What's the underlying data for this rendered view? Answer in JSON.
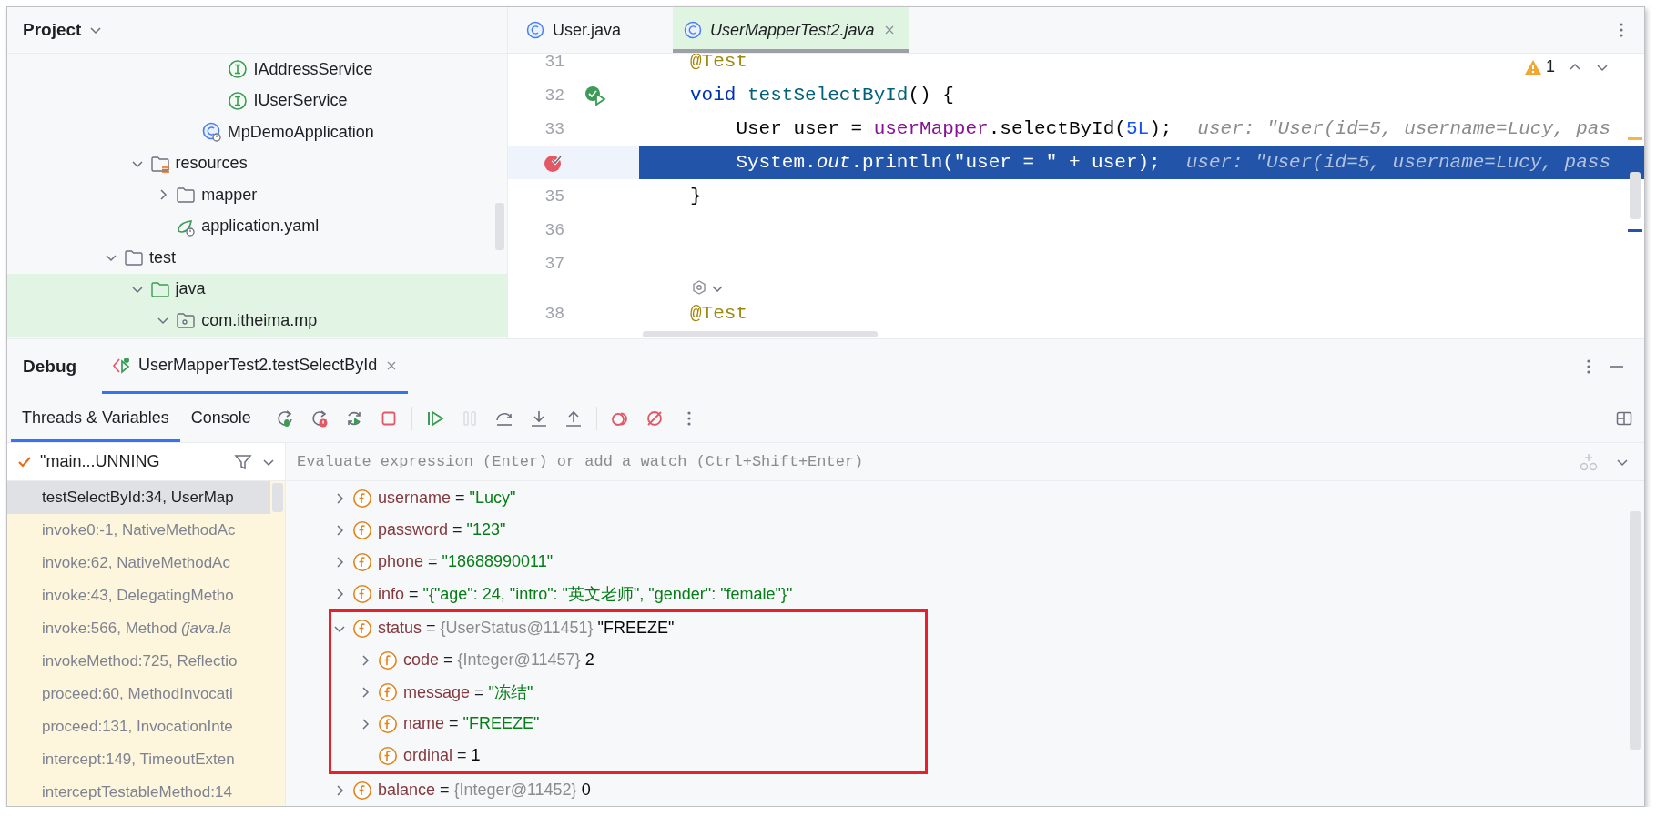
{
  "project_panel": {
    "title": "Project",
    "tree": [
      {
        "children": [
          {
            "children": [
              {
                "children": [
                  {
                    "children": [
                      {
                        "label": "IAddressService",
                        "kind": "interface",
                        "highlighted": false
                      },
                      {
                        "label": "IUserService",
                        "kind": "interface",
                        "highlighted": false
                      }
                    ]
                  },
                  {
                    "label": "MpDemoApplication",
                    "kind": "app-class",
                    "highlighted": false
                  }
                ]
              }
            ]
          },
          {
            "label": "resources",
            "kind": "resource-folder",
            "expanded": true,
            "highlighted": false,
            "children": [
              {
                "label": "mapper",
                "kind": "folder",
                "expanded": false,
                "highlighted": false
              },
              {
                "label": "application.yaml",
                "kind": "yaml",
                "highlighted": false
              }
            ]
          }
        ]
      },
      {
        "label": "test",
        "kind": "folder",
        "expanded": true,
        "highlighted": false,
        "children": [
          {
            "label": "java",
            "kind": "test-folder",
            "expanded": true,
            "highlighted": true,
            "children": [
              {
                "label": "com.itheima.mp",
                "kind": "package",
                "expanded": true,
                "highlighted": true
              }
            ]
          }
        ]
      }
    ]
  },
  "editor": {
    "tabs": [
      {
        "label": "User.java",
        "selected": false
      },
      {
        "label": "UserMapperTest2.java",
        "selected": true
      }
    ],
    "warning_count": "1",
    "lines": [
      {
        "kind": "code",
        "number": "31",
        "current": false,
        "run_marker": false,
        "breakpoint": false,
        "tokens": [
          {
            "text": "@Test",
            "kind": "annotation"
          }
        ]
      },
      {
        "kind": "code",
        "number": "32",
        "current": false,
        "run_marker": true,
        "breakpoint": false,
        "tokens": [
          {
            "text": "void ",
            "kind": "keyword"
          },
          {
            "text": "testSelectById",
            "kind": "method"
          },
          {
            "text": "() {",
            "kind": "plain"
          }
        ]
      },
      {
        "kind": "code",
        "number": "33",
        "current": false,
        "run_marker": false,
        "breakpoint": false,
        "tokens": [
          {
            "text": "    User user = ",
            "kind": "plain"
          },
          {
            "text": "userMapper",
            "kind": "field"
          },
          {
            "text": ".selectById(",
            "kind": "plain"
          },
          {
            "text": "5L",
            "kind": "number"
          },
          {
            "text": ");",
            "kind": "plain"
          }
        ],
        "hint": "user: \"User(id=5, username=Lucy, pas"
      },
      {
        "kind": "code",
        "current": true,
        "run_marker": false,
        "breakpoint": true,
        "tokens": [
          {
            "text": "    System.",
            "kind": "plain"
          },
          {
            "text": "out",
            "kind": "static"
          },
          {
            "text": ".println(\"user = \" + user);",
            "kind": "plain"
          }
        ],
        "hint": "user: \"User(id=5, username=Lucy, pass"
      },
      {
        "kind": "code",
        "number": "35",
        "current": false,
        "run_marker": false,
        "breakpoint": false,
        "tokens": [
          {
            "text": "}",
            "kind": "plain"
          }
        ]
      },
      {
        "kind": "code",
        "number": "36",
        "current": false,
        "run_marker": false,
        "breakpoint": false
      },
      {
        "kind": "code",
        "number": "37",
        "current": false,
        "run_marker": false,
        "breakpoint": false
      },
      {
        "kind": "inlay"
      },
      {
        "kind": "code",
        "number": "38",
        "current": false,
        "run_marker": false,
        "breakpoint": false,
        "tokens": [
          {
            "text": "@Test",
            "kind": "annotation"
          }
        ]
      }
    ]
  },
  "debug": {
    "title": "Debug",
    "session_tab": {
      "label": "UserMapperTest2.testSelectById"
    },
    "tabs": [
      {
        "label": "Threads & Variables",
        "selected": true
      },
      {
        "label": "Console",
        "selected": false
      }
    ],
    "toolbar": [
      {
        "kind": "rerun",
        "disabled": false
      },
      {
        "kind": "rerun-failed",
        "disabled": false
      },
      {
        "kind": "restart",
        "disabled": false
      },
      {
        "kind": "stop",
        "disabled": false
      },
      {
        "kind": "separator"
      },
      {
        "kind": "resume",
        "disabled": false
      },
      {
        "kind": "pause",
        "disabled": true
      },
      {
        "kind": "step-over",
        "disabled": false
      },
      {
        "kind": "step-into",
        "disabled": false
      },
      {
        "kind": "step-out",
        "disabled": false
      },
      {
        "kind": "separator"
      },
      {
        "kind": "breakpoints",
        "disabled": false
      },
      {
        "kind": "mute-breakpoints",
        "disabled": false
      },
      {
        "kind": "more",
        "disabled": false
      }
    ],
    "thread": {
      "label": "\"main...UNNING"
    },
    "frames": [
      {
        "text": "testSelectById:34, UserMap",
        "selected": true,
        "library": false
      },
      {
        "text": "invoke0:-1, NativeMethodAc",
        "selected": false,
        "library": true
      },
      {
        "text": "invoke:62, NativeMethodAc",
        "selected": false,
        "library": true
      },
      {
        "text": "invoke:43, DelegatingMetho",
        "selected": false,
        "library": true
      },
      {
        "text": "invoke:566, Method *(java.la*",
        "selected": false,
        "library": true
      },
      {
        "text": "invokeMethod:725, Reflectio",
        "selected": false,
        "library": true
      },
      {
        "text": "proceed:60, MethodInvocati",
        "selected": false,
        "library": true
      },
      {
        "text": "proceed:131, InvocationInte",
        "selected": false,
        "library": true
      },
      {
        "text": "intercept:149, TimeoutExten",
        "selected": false,
        "library": true
      },
      {
        "text": "interceptTestableMethod:14",
        "selected": false,
        "library": true
      }
    ],
    "evaluate": {
      "placeholder": "Evaluate expression (Enter) or add a watch (Ctrl+Shift+Enter)"
    },
    "variables": [
      {
        "name": "username",
        "operator": "=",
        "value": "\"Lucy\"",
        "kind": "string",
        "expanded": false,
        "boxed": false
      },
      {
        "name": "password",
        "operator": "=",
        "value": "\"123\"",
        "kind": "string",
        "expanded": false,
        "boxed": false
      },
      {
        "name": "phone",
        "operator": "=",
        "value": "\"18688990011\"",
        "kind": "string",
        "expanded": false,
        "boxed": false
      },
      {
        "name": "info",
        "operator": "=",
        "value": "\"{\"age\": 24, \"intro\": \"英文老师\", \"gender\": \"female\"}\"",
        "kind": "string",
        "expanded": false,
        "boxed": false
      },
      {
        "name": "status",
        "operator": "=",
        "type_ref": "{UserStatus@11451}",
        "value": "\"FREEZE\"",
        "kind": "plain",
        "expanded": true,
        "boxed": true,
        "children": [
          {
            "name": "code",
            "operator": "=",
            "type_ref": "{Integer@11457}",
            "value": "2",
            "kind": "plain",
            "expanded": false
          },
          {
            "name": "message",
            "operator": "=",
            "value": "\"冻结\"",
            "kind": "string",
            "expanded": false
          },
          {
            "name": "name",
            "operator": "=",
            "value": "\"FREEZE\"",
            "kind": "string",
            "expanded": false
          },
          {
            "name": "ordinal",
            "operator": "=",
            "value": "1",
            "kind": "plain"
          }
        ]
      },
      {
        "name": "balance",
        "operator": "=",
        "type_ref": "{Integer@11452}",
        "value": "0",
        "kind": "plain",
        "expanded": false,
        "boxed": false
      }
    ]
  }
}
